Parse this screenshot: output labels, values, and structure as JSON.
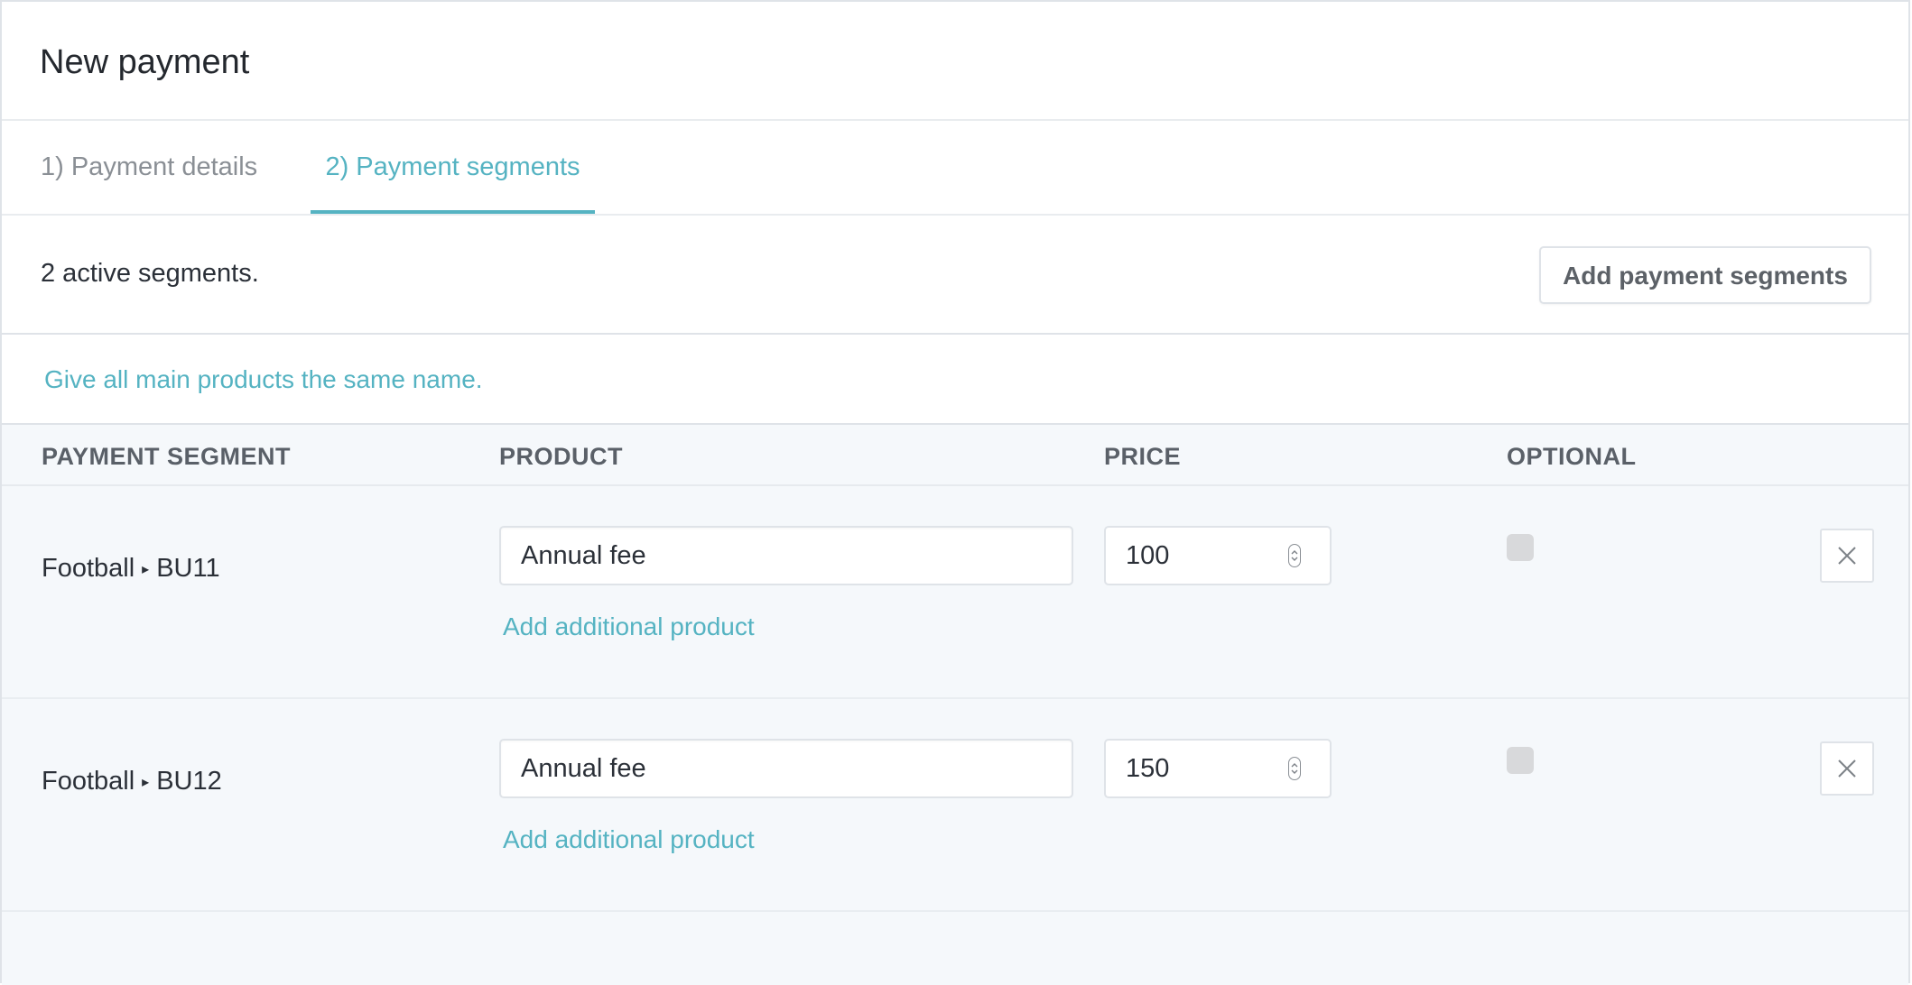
{
  "header": {
    "title": "New payment"
  },
  "tabs": [
    {
      "label": "1) Payment details",
      "active": false
    },
    {
      "label": "2) Payment segments",
      "active": true
    }
  ],
  "summary": {
    "text": "2 active segments.",
    "add_button_label": "Add payment segments"
  },
  "same_name_link": "Give all main products the same name.",
  "table": {
    "columns": [
      "PAYMENT SEGMENT",
      "PRODUCT",
      "PRICE",
      "OPTIONAL"
    ],
    "rows": [
      {
        "segment_group": "Football",
        "segment_separator": "▸",
        "segment_name": "BU11",
        "product": "Annual fee",
        "price": "100",
        "optional": false,
        "add_product_label": "Add additional product"
      },
      {
        "segment_group": "Football",
        "segment_separator": "▸",
        "segment_name": "BU12",
        "product": "Annual fee",
        "price": "150",
        "optional": false,
        "add_product_label": "Add additional product"
      }
    ]
  },
  "icons": {
    "remove": "close-icon",
    "spinner": "number-spinner-icon"
  },
  "colors": {
    "accent": "#55b3c2",
    "table_bg": "#f5f8fb",
    "border": "#dfe3e8",
    "checkbox": "#d8d9db"
  }
}
